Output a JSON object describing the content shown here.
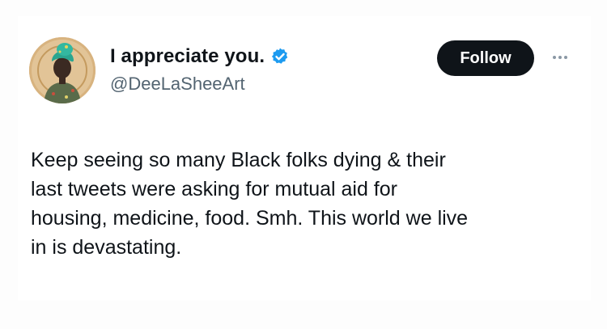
{
  "tweet": {
    "display_name": "I appreciate you.",
    "handle": "@DeeLaSheeArt",
    "verified": true,
    "follow_label": "Follow",
    "text_lines": [
      "Keep seeing so many Black folks dying & their",
      "last tweets were asking for mutual aid for",
      "housing, medicine, food. Smh. This world we live",
      "in is devastating."
    ]
  },
  "icons": {
    "avatar": "avatar-illustration",
    "verified": "verified-badge-icon",
    "more": "more-options-icon"
  },
  "colors": {
    "verified_blue": "#1d9bf0",
    "follow_bg": "#0f1419",
    "handle_gray": "#536471"
  }
}
